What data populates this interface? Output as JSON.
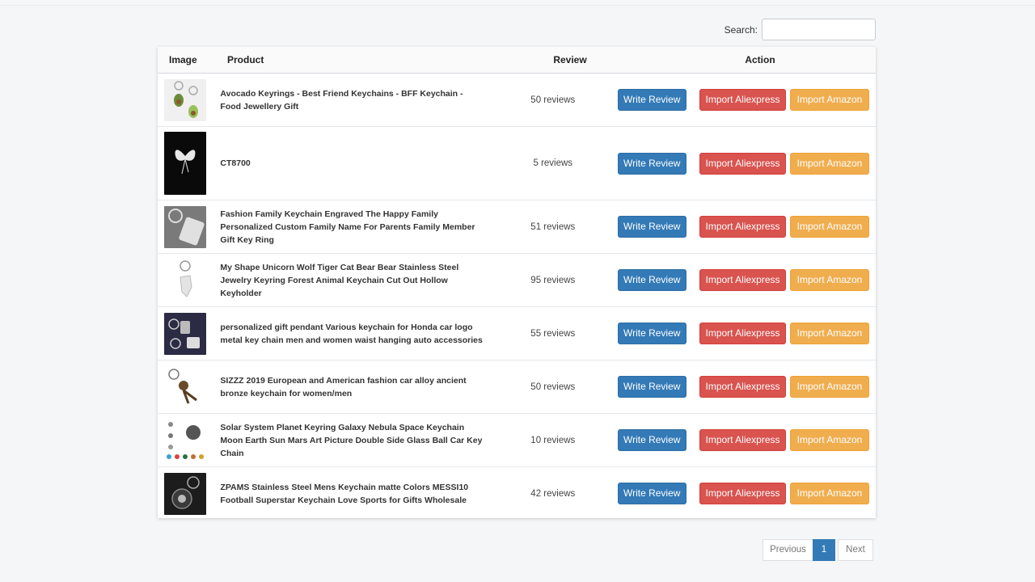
{
  "search": {
    "label": "Search:",
    "value": "",
    "placeholder": ""
  },
  "table": {
    "headers": {
      "image": "Image",
      "product": "Product",
      "review": "Review",
      "action": "Action"
    },
    "rows": [
      {
        "product": "Avocado Keyrings - Best Friend Keychains - BFF Keychain - Food Jewellery Gift",
        "reviews": "50 reviews"
      },
      {
        "product": "CT8700",
        "reviews": "5 reviews"
      },
      {
        "product": "Fashion Family Keychain Engraved The Happy Family Personalized Custom Family Name For Parents Family Member Gift Key Ring",
        "reviews": "51 reviews"
      },
      {
        "product": "My Shape Unicorn Wolf Tiger Cat Bear Bear Stainless Steel Jewelry Keyring Forest Animal Keychain Cut Out Hollow Keyholder",
        "reviews": "95 reviews"
      },
      {
        "product": "personalized gift pendant Various keychain for Honda car logo metal key chain men and women waist hanging auto accessories",
        "reviews": "55 reviews"
      },
      {
        "product": "SIZZZ 2019 European and American fashion car alloy ancient bronze keychain for women/men",
        "reviews": "50 reviews"
      },
      {
        "product": "Solar System Planet Keyring Galaxy Nebula Space Keychain Moon Earth Sun Mars Art Picture Double Side Glass Ball Car Key Chain",
        "reviews": "10 reviews"
      },
      {
        "product": "ZPAMS Stainless Steel Mens Keychain matte Colors MESSI10 Football Superstar Keychain Love Sports for Gifts Wholesale",
        "reviews": "42 reviews"
      }
    ]
  },
  "buttons": {
    "write": "Write Review",
    "ali": "Import Aliexpress",
    "amazon": "Import Amazon"
  },
  "pagination": {
    "previous": "Previous",
    "current": "1",
    "next": "Next"
  },
  "colors": {
    "primary": "#337ab7",
    "danger": "#d9534f",
    "warning": "#f0ad4e"
  }
}
